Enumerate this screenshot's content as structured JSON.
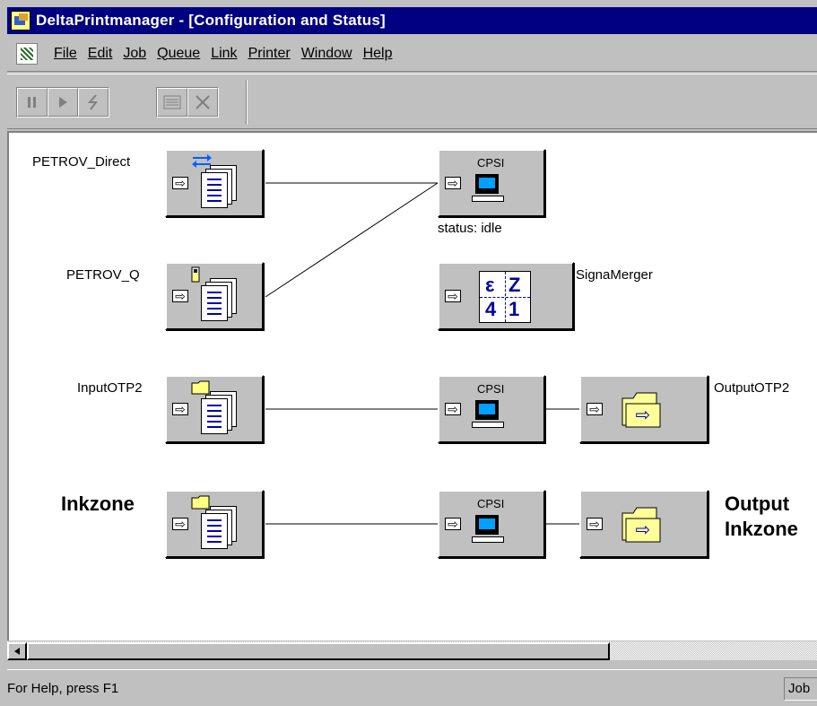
{
  "window": {
    "title": "DeltaPrintmanager - [Configuration and Status]"
  },
  "menu": {
    "items": [
      "File",
      "Edit",
      "Job",
      "Queue",
      "Link",
      "Printer",
      "Window",
      "Help"
    ]
  },
  "toolbar": {
    "buttons": [
      {
        "icon": "pause-icon",
        "enabled": false
      },
      {
        "icon": "play-icon",
        "enabled": false
      },
      {
        "icon": "flash-icon",
        "enabled": false
      },
      {
        "icon": "properties-icon",
        "enabled": false
      },
      {
        "icon": "delete-icon",
        "enabled": false
      }
    ]
  },
  "nodes": {
    "petrov_direct": {
      "label": "PETROV_Direct"
    },
    "petrov_q": {
      "label": "PETROV_Q"
    },
    "cpsi_top": {
      "title": "CPSI",
      "status": "status: idle"
    },
    "signa": {
      "label": "SignaMerger",
      "digits": [
        "ε",
        "Z",
        "4",
        "1"
      ]
    },
    "input_otp2": {
      "label": "InputOTP2"
    },
    "cpsi_mid": {
      "title": "CPSI"
    },
    "output_otp2": {
      "label": "OutputOTP2"
    },
    "inkzone": {
      "label": "Inkzone"
    },
    "cpsi_bottom": {
      "title": "CPSI"
    },
    "output_inkzone": {
      "label_line1": "Output",
      "label_line2": "Inkzone"
    }
  },
  "statusbar": {
    "help_text": "For Help, press F1",
    "pane_text": "Job"
  },
  "colors": {
    "titlebar": "#000080",
    "window_face": "#c0c0c0",
    "canvas": "#ffffff",
    "folder_fill": "#ffff99",
    "arrow_blue": "#0000c0"
  }
}
